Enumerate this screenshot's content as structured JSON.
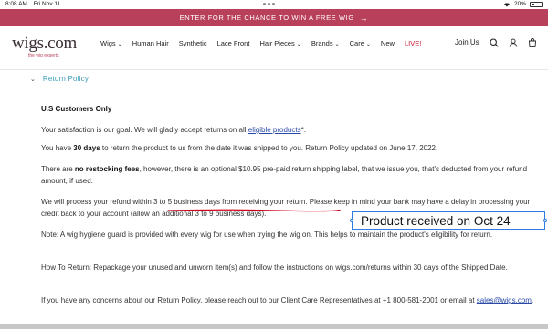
{
  "status_bar": {
    "time": "8:08 AM",
    "date": "Fri Nov 11",
    "battery": "20%"
  },
  "promo": {
    "text": "ENTER FOR THE CHANCE TO WIN A FREE WIG",
    "arrow": "→"
  },
  "logo": {
    "main": "wigs.com",
    "tagline": "the wig experts"
  },
  "nav": {
    "items": [
      {
        "label": "Wigs",
        "has_dropdown": true
      },
      {
        "label": "Human Hair",
        "has_dropdown": false
      },
      {
        "label": "Synthetic",
        "has_dropdown": false
      },
      {
        "label": "Lace Front",
        "has_dropdown": false
      },
      {
        "label": "Hair Pieces",
        "has_dropdown": true
      },
      {
        "label": "Brands",
        "has_dropdown": true
      },
      {
        "label": "Care",
        "has_dropdown": true
      },
      {
        "label": "New",
        "has_dropdown": false
      },
      {
        "label": "LIVE!",
        "has_dropdown": false
      }
    ],
    "dropdown_glyph": "⌄",
    "join_us": "Join Us"
  },
  "accordion": {
    "title": "Return Policy",
    "chevron": "⌄"
  },
  "policy": {
    "heading": "U.S Customers Only",
    "p1_pre": "Your satisfaction is our goal. We will gladly accept returns on all ",
    "p1_link": "eligible products",
    "p1_post": "*.",
    "p2_pre": "You have ",
    "p2_bold": "30 days",
    "p2_post": " to return the product to us from the date it was shipped to you. Return Policy updated on June 17, 2022.",
    "p3_pre": "There are ",
    "p3_bold": "no restocking fees",
    "p3_post": ", however, there is an optional $10.95 pre-paid return shipping label, that we issue you, that's deducted from your refund amount, if used.",
    "p4": "We will process your refund within 3 to 5 business days from receiving your return. Please keep in mind your bank may have a delay in processing your credit back to your account (allow an additional 3 to 9 business days).",
    "p5": "Note: A wig hygiene guard is provided with every wig for use when trying the wig on. This helps to maintain the product's eligibility for return.",
    "p6": "How To Return: Repackage your unused and unworn item(s) and follow the instructions on wigs.com/returns within 30 days of the Shipped Date.",
    "p7_pre": "If you have any concerns about our Return Policy, please reach out to our Client Care Representatives at +1 800-581-2001 or email at ",
    "p7_link": "sales@wigs.com",
    "p7_post": "."
  },
  "annotation": {
    "text": "Product received on Oct 24"
  },
  "colors": {
    "banner": "#b8405a",
    "accordion_title": "#3a9bb8",
    "link": "#2a4aa8",
    "annotation_border": "#2f7de1",
    "underline": "#d0021b"
  }
}
